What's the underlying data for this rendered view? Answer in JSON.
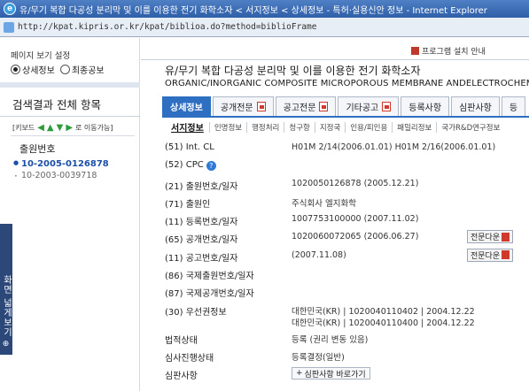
{
  "window": {
    "title": "유/무기 복합 다공성 분리막 및 이를 이용한 전기 화학소자 < 서지정보 < 상세정보 - 특허·실용신안 정보 - Internet Explorer",
    "url": "http://kpat.kipris.or.kr/kpat/biblioa.do?method=biblioFrame"
  },
  "left": {
    "view_setting_label": "페이지 보기 설정",
    "radio_detail": "상세정보",
    "radio_final": "최종공보",
    "results_title": "검색결과 전체 항목",
    "keyboard_label": "[키보드",
    "keyboard_nav": "로 이동가능]",
    "app_no_heading": "출원번호",
    "app_numbers": [
      "10-2005-0126878",
      "10-2003-0039718"
    ],
    "side_tab": "화면 넓게보기"
  },
  "main": {
    "install_guide": "프로그램 설치 안내",
    "title_ko": "유/무기 복합 다공성 분리막 및 이를 이용한 전기 화학소자",
    "title_en": "ORGANIC/INORGANIC COMPOSITE MICROPOROUS MEMBRANE ANDELECTROCHEMICAL",
    "tabs": [
      "상세정보",
      "공개전문",
      "공고전문",
      "기타공고",
      "등록사항",
      "심판사항",
      "등"
    ],
    "subtabs": [
      "서지정보",
      "인명정보",
      "행정처리",
      "청구항",
      "지정국",
      "인용/피인용",
      "패밀리정보",
      "국가R&D연구정보"
    ],
    "rows": {
      "int_cl": {
        "label": "(51) Int. CL",
        "value": "H01M 2/14(2006.01.01) H01M 2/16(2006.01.01)"
      },
      "cpc": {
        "label": "(52) CPC"
      },
      "app_no": {
        "label": "(21) 출원번호/일자",
        "value": "1020050126878 (2005.12.21)"
      },
      "applicant": {
        "label": "(71) 출원인",
        "value": "주식회사 엘지화학"
      },
      "reg_no": {
        "label": "(11) 등록번호/일자",
        "value": "1007753100000 (2007.11.02)"
      },
      "pub_no": {
        "label": "(65) 공개번호/일자",
        "value": "1020060072065 (2006.06.27)"
      },
      "ann_no": {
        "label": "(11) 공고번호/일자",
        "value": "(2007.11.08)"
      },
      "intl_app": {
        "label": "(86) 국제출원번호/일자"
      },
      "intl_pub": {
        "label": "(87) 국제공개번호/일자"
      },
      "priority": {
        "label": "(30) 우선권정보",
        "value1": "대한민국(KR) | 1020040110402 | 2004.12.22",
        "value2": "대한민국(KR) | 1020040110400 | 2004.12.22"
      },
      "legal_status": {
        "label": "법적상태",
        "value": "등록 (권리 변동 있음)"
      },
      "exam_status": {
        "label": "심사진행상태",
        "value": "등록결정(일반)"
      },
      "trial": {
        "label": "심판사항",
        "value": "심판사항 바로가기"
      }
    },
    "full_text_button": "전문다운"
  }
}
